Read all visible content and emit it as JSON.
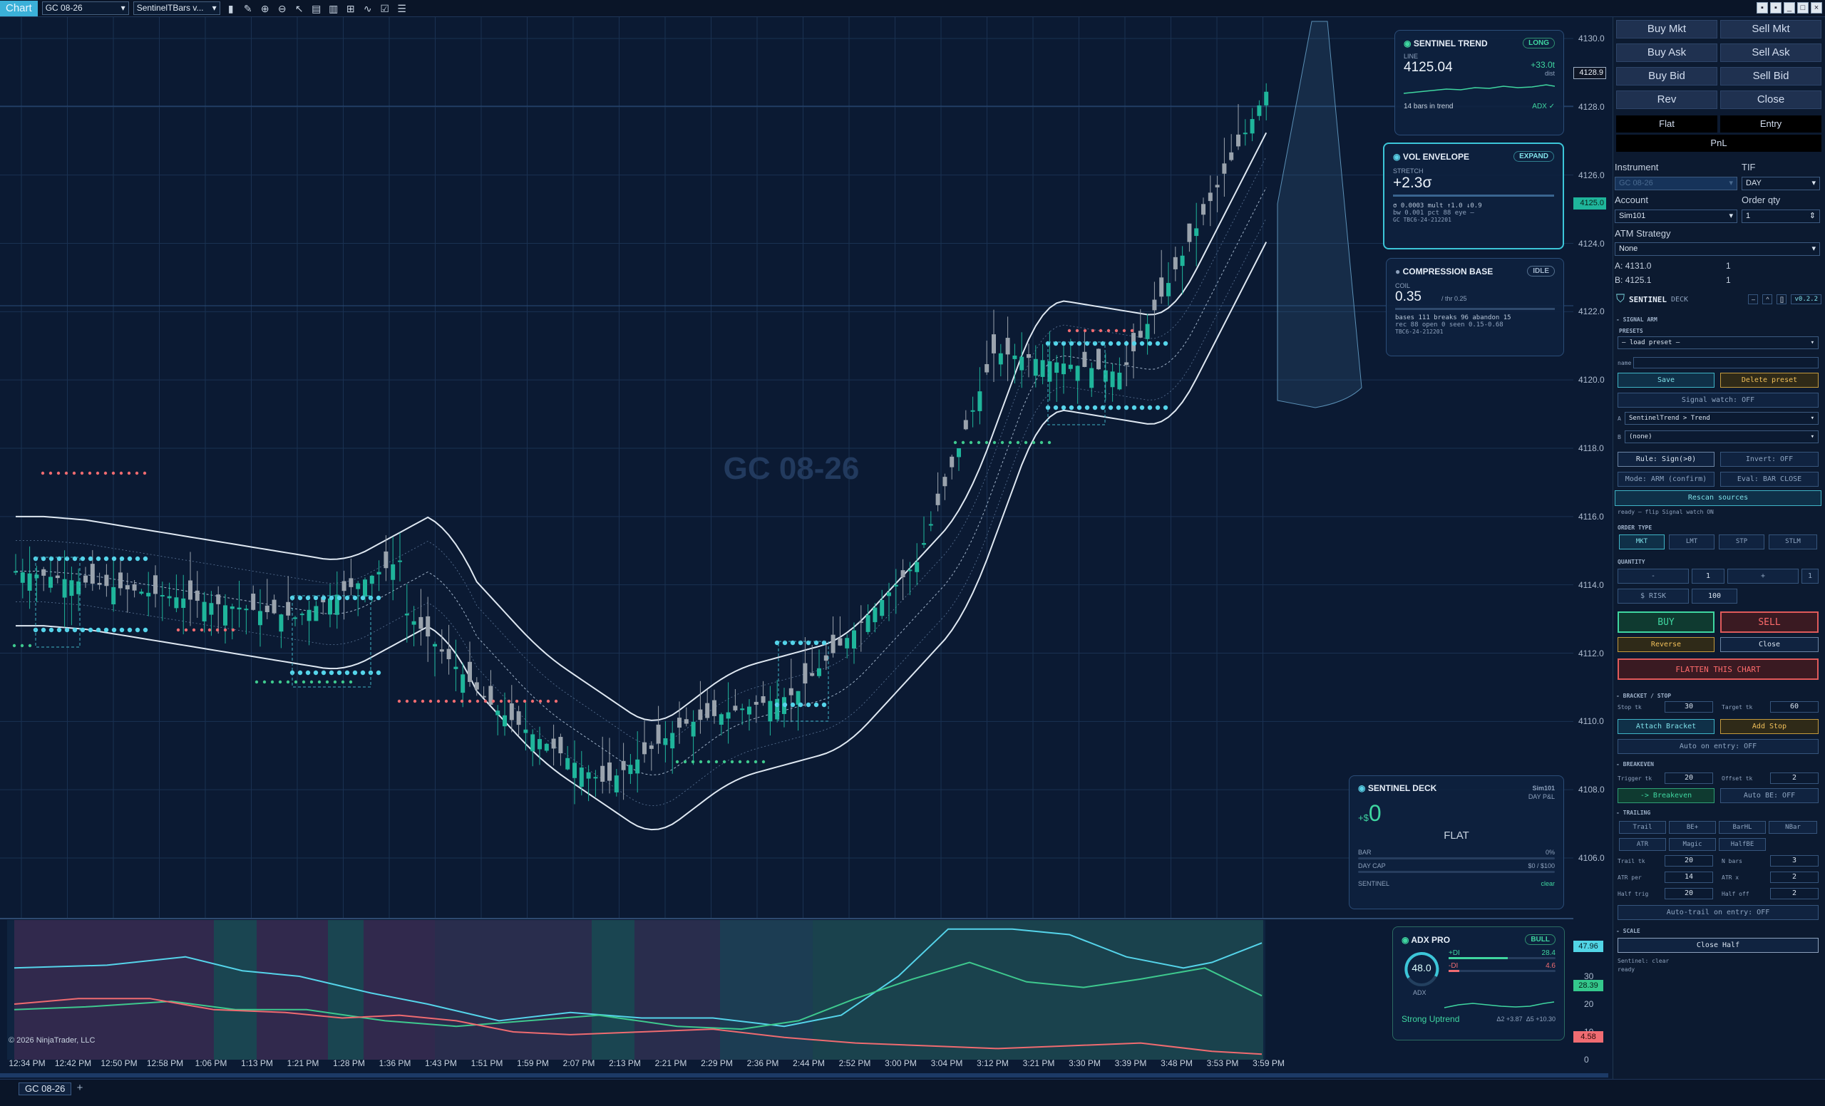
{
  "topbar": {
    "tab": "Chart",
    "instrument": "GC 08-26",
    "template": "SentinelTBars v..."
  },
  "watermark": "GC 08-26",
  "copyright": "© 2026 NinjaTrader, LLC",
  "price_axis": [
    "4130.0",
    "4128.0",
    "4126.0",
    "4124.0",
    "4122.0",
    "4120.0",
    "4118.0",
    "4116.0",
    "4114.0",
    "4112.0",
    "4110.0",
    "4108.0",
    "4106.0"
  ],
  "price_tags": {
    "last": "4128.9",
    "entry": "4125.0"
  },
  "adx_axis": [
    "40",
    "30",
    "20",
    "10",
    "0"
  ],
  "adx_tags": {
    "plus_di": "47.96",
    "minus_di": "28.39",
    "low": "4.58"
  },
  "time_labels": [
    "12:34 PM",
    "12:42 PM",
    "12:50 PM",
    "12:58 PM",
    "1:06 PM",
    "1:13 PM",
    "1:21 PM",
    "1:28 PM",
    "1:36 PM",
    "1:43 PM",
    "1:51 PM",
    "1:59 PM",
    "2:07 PM",
    "2:13 PM",
    "2:21 PM",
    "2:29 PM",
    "2:36 PM",
    "2:44 PM",
    "2:52 PM",
    "3:00 PM",
    "3:04 PM",
    "3:12 PM",
    "3:21 PM",
    "3:30 PM",
    "3:39 PM",
    "3:48 PM",
    "3:53 PM",
    "3:59 PM"
  ],
  "cards": {
    "trend": {
      "title": "SENTINEL TREND",
      "pill": "LONG",
      "line_lbl": "LINE",
      "value": "4125.04",
      "delta": "+33.0t",
      "delta_lbl": "dist",
      "footer": "14 bars in trend",
      "adx": "ADX ✓"
    },
    "vol": {
      "title": "VOL ENVELOPE",
      "pill": "EXPAND",
      "stretch_lbl": "STRETCH",
      "value": "+2.3σ",
      "line1": "σ 0.0003   mult ↑1.0 ↓0.9",
      "line2": "bw 0.001   pct 88   eye —",
      "line3": "GC  TBC6-24-212201"
    },
    "comp": {
      "title": "COMPRESSION BASE",
      "pill": "IDLE",
      "coil_lbl": "COIL",
      "value": "0.35",
      "thr": "/ thr 0.25",
      "line1": "bases 111   breaks 96   abandon 15",
      "line2": "rec 88   open 0   seen 0.15-0.68",
      "line3": "TBC6-24-212201"
    },
    "deck": {
      "title": "SENTINEL DECK",
      "account": "Sim101",
      "daypnl_lbl": "DAY P&L",
      "pnl_prefix": "+$",
      "pnl": "0",
      "state": "FLAT",
      "bar_lbl": "BAR",
      "bar_val": "0%",
      "cap_lbl": "DAY CAP",
      "cap_val": "$0 / $100",
      "footer": "SENTINEL",
      "footer_r": "clear"
    },
    "adx": {
      "title": "ADX PRO",
      "pill": "BULL",
      "value": "48.0",
      "dial_lbl": "ADX",
      "plus_lbl": "+DI",
      "plus_val": "28.4",
      "minus_lbl": "-DI",
      "minus_val": "4.6",
      "state": "Strong Uptrend",
      "d1": "Δ2 +3.87",
      "d2": "Δ5 +10.30"
    }
  },
  "panel": {
    "buy_mkt": "Buy Mkt",
    "sell_mkt": "Sell Mkt",
    "buy_ask": "Buy Ask",
    "sell_ask": "Sell Ask",
    "buy_bid": "Buy Bid",
    "sell_bid": "Sell Bid",
    "rev": "Rev",
    "close": "Close",
    "flat": "Flat",
    "entry": "Entry",
    "pnl": "PnL",
    "instrument_lbl": "Instrument",
    "instrument": "GC 08-26",
    "tif_lbl": "TIF",
    "tif": "DAY",
    "account_lbl": "Account",
    "account": "Sim101",
    "qty_lbl": "Order qty",
    "qty": "1",
    "atm_lbl": "ATM Strategy",
    "atm": "None",
    "a_lbl": "A:",
    "a_price": "4131.0",
    "a_qty": "1",
    "b_lbl": "B:",
    "b_price": "4125.1",
    "b_qty": "1",
    "deck_title": "SENTINEL",
    "deck_sub": "DECK",
    "version": "v0.2.2",
    "signal_arm": "SIGNAL ARM",
    "presets": "PRESETS",
    "preset_dd": "— load preset —",
    "name_lbl": "name",
    "save": "Save",
    "delete": "Delete preset",
    "signal_watch": "Signal watch: OFF",
    "src_a_lbl": "A",
    "src_a": "SentinelTrend > Trend",
    "src_b_lbl": "B",
    "src_b": "(none)",
    "rule": "Rule: Sign(>0)",
    "invert": "Invert: OFF",
    "mode": "Mode: ARM (confirm)",
    "eval": "Eval: BAR CLOSE",
    "rescan": "Rescan sources",
    "status": "ready — flip Signal watch ON",
    "order_type": "ORDER TYPE",
    "ot": [
      "MKT",
      "LMT",
      "STP",
      "STLM"
    ],
    "quantity": "QUANTITY",
    "minus": "-",
    "qty_val": "1",
    "plus": "+",
    "one": "1",
    "risk": "$ RISK",
    "risk_val": "100",
    "buy": "BUY",
    "sell": "SELL",
    "reverse": "Reverse",
    "close2": "Close",
    "flatten": "FLATTEN THIS CHART",
    "bracket": "BRACKET / STOP",
    "stop_lbl": "Stop tk",
    "stop_val": "30",
    "target_lbl": "Target tk",
    "target_val": "60",
    "attach": "Attach Bracket",
    "addstop": "Add Stop",
    "auto_entry": "Auto on entry: OFF",
    "breakeven": "BREAKEVEN",
    "trig_lbl": "Trigger tk",
    "trig_val": "20",
    "off_lbl": "Offset tk",
    "off_val": "2",
    "be_btn": "-> Breakeven",
    "auto_be": "Auto BE: OFF",
    "trailing": "TRAILING",
    "tr": [
      "Trail",
      "BE+",
      "BarHL",
      "NBar",
      "ATR",
      "Magic",
      "HalfBE"
    ],
    "trail_lbl": "Trail tk",
    "trail_val": "20",
    "nbars_lbl": "N bars",
    "nbars_val": "3",
    "atrper_lbl": "ATR per",
    "atrper_val": "14",
    "atrx_lbl": "ATR x",
    "atrx_val": "2",
    "halftrig_lbl": "Half trig",
    "halftrig_val": "20",
    "halfoff_lbl": "Half off",
    "halfoff_val": "2",
    "autotrail": "Auto-trail on entry: OFF",
    "scale": "SCALE",
    "closehalf": "Close Half",
    "sent_status": "Sentinel: clear",
    "ready": "ready"
  },
  "bottom": {
    "tab": "GC 08-26",
    "add": "+"
  }
}
